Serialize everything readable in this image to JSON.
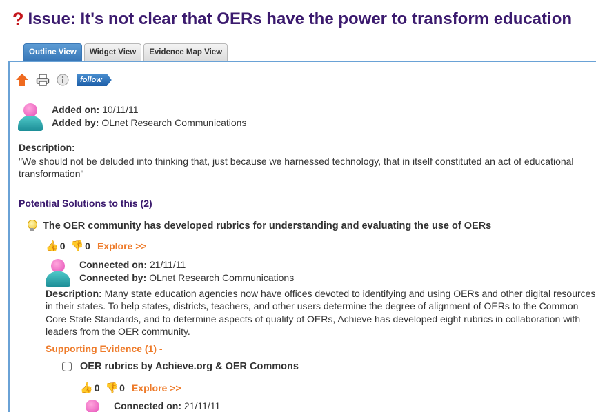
{
  "issue": {
    "icon": "?",
    "title": "Issue: It's not clear that OERs have the power to transform education"
  },
  "tabs": [
    {
      "label": "Outline View",
      "active": true
    },
    {
      "label": "Widget View",
      "active": false
    },
    {
      "label": "Evidence Map View",
      "active": false
    }
  ],
  "toolbar": {
    "follow_label": "follow",
    "icons": [
      "up-arrow-icon",
      "printer-icon",
      "info-icon"
    ]
  },
  "added": {
    "on_label": "Added on:",
    "on_value": "10/11/11",
    "by_label": "Added by:",
    "by_value": "OLnet Research Communications"
  },
  "description": {
    "label": "Description:",
    "text": "\"We should not be deluded into thinking that, just because we harnessed technology, that in itself constituted an act of educational transformation\""
  },
  "solutions": {
    "heading": "Potential Solutions to this (2)",
    "item": {
      "title": "The OER community has developed rubrics for understanding and evaluating the use of OERs",
      "votes_up": "0",
      "votes_down": "0",
      "explore_label": "Explore >>",
      "connected_on_label": "Connected on:",
      "connected_on_value": "21/11/11",
      "connected_by_label": "Connected by:",
      "connected_by_value": "OLnet Research Communications",
      "desc_label": "Description:",
      "desc_text": "Many state education agencies now have offices devoted to identifying and using OERs and other digital resources in their states. To help states, districts, teachers, and other users determine the degree of alignment of OERs to the Common Core State Standards, and to determine aspects of quality of OERs, Achieve has developed eight rubrics in collaboration with leaders from the OER community.",
      "supporting_heading": "Supporting Evidence (1) -",
      "evidence": {
        "title": "OER rubrics by Achieve.org & OER Commons",
        "votes_up": "0",
        "votes_down": "0",
        "explore_label": "Explore >>",
        "connected_on_label": "Connected on:",
        "connected_on_value": "21/11/11"
      }
    }
  },
  "colors": {
    "title": "#3b1a6e",
    "question_mark": "#c4161c",
    "active_tab": "#3877b8",
    "accent_orange": "#ee7b2a",
    "panel_border": "#6aa2d6"
  }
}
